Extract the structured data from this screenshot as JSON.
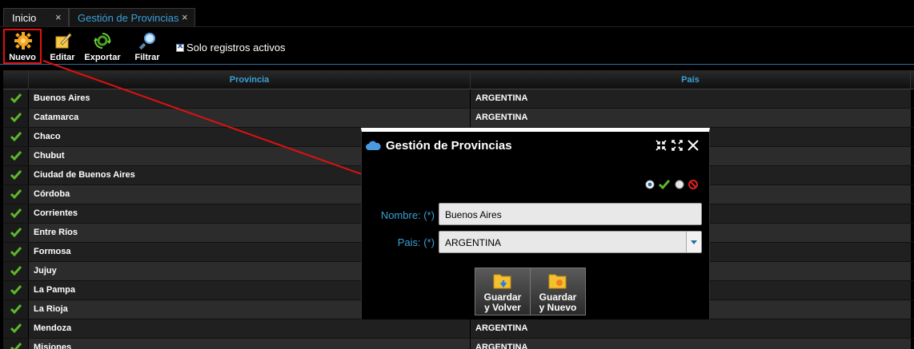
{
  "tabs": [
    {
      "label": "Inicio",
      "close": "×"
    },
    {
      "label": "Gestión de Provincias",
      "close": "×"
    }
  ],
  "toolbar": {
    "nuevo": "Nuevo",
    "editar": "Editar",
    "exportar": "Exportar",
    "filtrar": "Filtrar",
    "solo_activos": "Solo registros activos"
  },
  "grid": {
    "columns": [
      "Provincia",
      "País"
    ],
    "rows": [
      {
        "provincia": "Buenos Aires",
        "pais": "ARGENTINA"
      },
      {
        "provincia": "Catamarca",
        "pais": "ARGENTINA"
      },
      {
        "provincia": "Chaco",
        "pais": ""
      },
      {
        "provincia": "Chubut",
        "pais": ""
      },
      {
        "provincia": "Ciudad de Buenos Aires",
        "pais": ""
      },
      {
        "provincia": "Córdoba",
        "pais": ""
      },
      {
        "provincia": "Corrientes",
        "pais": ""
      },
      {
        "provincia": "Entre Ríos",
        "pais": ""
      },
      {
        "provincia": "Formosa",
        "pais": ""
      },
      {
        "provincia": "Jujuy",
        "pais": ""
      },
      {
        "provincia": "La Pampa",
        "pais": ""
      },
      {
        "provincia": "La Rioja",
        "pais": ""
      },
      {
        "provincia": "Mendoza",
        "pais": "ARGENTINA"
      },
      {
        "provincia": "Misiones",
        "pais": "ARGENTINA"
      }
    ]
  },
  "modal": {
    "title": "Gestión de Provincias",
    "nombre_label": "Nombre: (*)",
    "nombre_value": "Buenos Aires",
    "pais_label": "Pais: (*)",
    "pais_value": "ARGENTINA",
    "guardar_volver": [
      "Guardar",
      "y Volver"
    ],
    "guardar_nuevo": [
      "Guardar",
      "y Nuevo"
    ]
  },
  "colors": {
    "accent": "#3aa0d8",
    "highlight": "#e01010",
    "check": "#5cb82a"
  }
}
